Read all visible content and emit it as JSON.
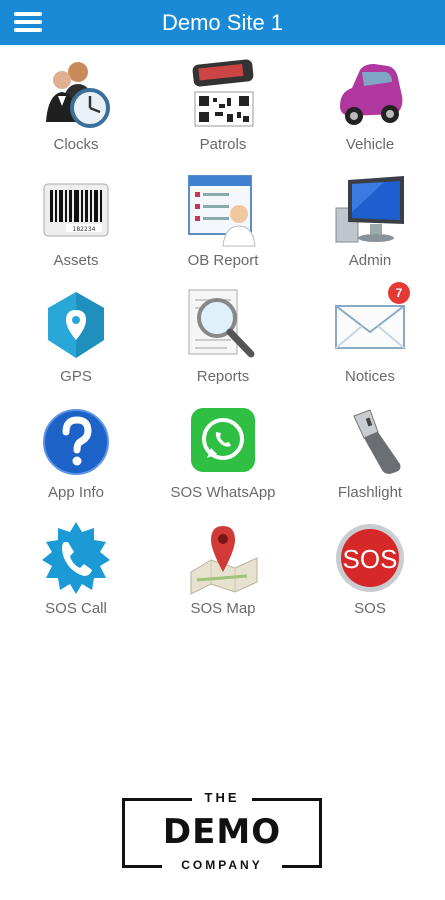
{
  "appbar": {
    "title": "Demo Site 1",
    "menu_icon": "hamburger-icon",
    "color": "#1a8ad6"
  },
  "tiles": [
    {
      "label": "Clocks",
      "icon": "clock-people-icon"
    },
    {
      "label": "Patrols",
      "icon": "phone-qr-icon"
    },
    {
      "label": "Vehicle",
      "icon": "car-icon"
    },
    {
      "label": "Assets",
      "icon": "barcode-icon"
    },
    {
      "label": "OB Report",
      "icon": "report-user-icon"
    },
    {
      "label": "Admin",
      "icon": "computer-icon"
    },
    {
      "label": "GPS",
      "icon": "location-pin-icon"
    },
    {
      "label": "Reports",
      "icon": "magnifier-document-icon"
    },
    {
      "label": "Notices",
      "icon": "envelope-icon",
      "badge": "7"
    },
    {
      "label": "App Info",
      "icon": "help-icon"
    },
    {
      "label": "SOS WhatsApp",
      "icon": "whatsapp-icon"
    },
    {
      "label": "Flashlight",
      "icon": "flashlight-icon"
    },
    {
      "label": "SOS Call",
      "icon": "phone-badge-icon"
    },
    {
      "label": "SOS Map",
      "icon": "map-pin-icon"
    },
    {
      "label": "SOS",
      "icon": "sos-button-icon",
      "icon_text": "SOS"
    }
  ],
  "logo": {
    "line1": "THE",
    "line2": "DEMO",
    "line3": "COMPANY"
  }
}
